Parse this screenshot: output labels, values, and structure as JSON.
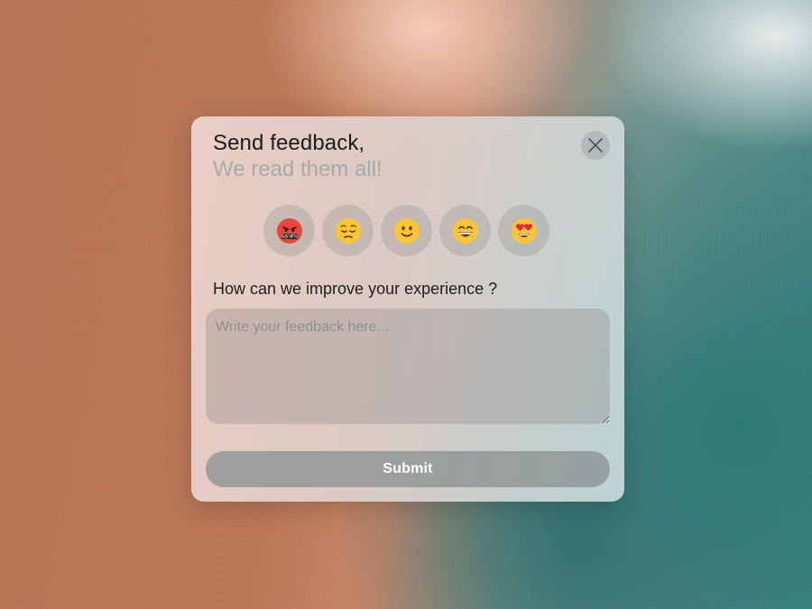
{
  "modal": {
    "title": "Send feedback,",
    "subtitle": "We read them all!",
    "close_icon": "close-icon"
  },
  "ratings": [
    {
      "icon": "angry-cursing-face-icon"
    },
    {
      "icon": "pensive-face-icon"
    },
    {
      "icon": "slightly-smiling-face-icon"
    },
    {
      "icon": "grinning-face-icon"
    },
    {
      "icon": "heart-eyes-face-icon"
    }
  ],
  "question": "How can we improve your experience ?",
  "feedback": {
    "placeholder": "Write your feedback here...",
    "value": ""
  },
  "submit_label": "Submit",
  "colors": {
    "title": "#1c1c1c",
    "subtitle": "#a6aaaa",
    "submit_bg": "#8c9292"
  }
}
